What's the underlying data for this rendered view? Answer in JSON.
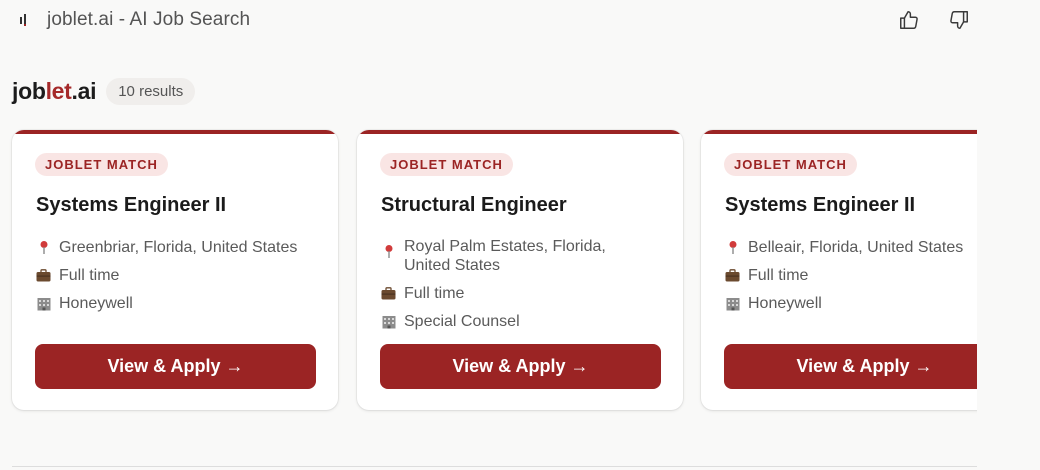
{
  "header": {
    "favicon_text": ".i",
    "title": "joblet.ai - AI Job Search",
    "thumbs_up_icon": "thumbs-up-icon",
    "thumbs_down_icon": "thumbs-down-icon"
  },
  "brand": {
    "part1": "job",
    "part2": "let",
    "part3": ".ai",
    "results": "10 results",
    "accent_color": "#9b2424"
  },
  "cards": [
    {
      "badge": "JOBLET MATCH",
      "title": "Systems Engineer II",
      "location": "Greenbriar, Florida, United States",
      "employment": "Full time",
      "company": "Honeywell",
      "apply_label": "View & Apply →"
    },
    {
      "badge": "JOBLET MATCH",
      "title": "Structural Engineer",
      "location": "Royal Palm Estates, Florida, United States",
      "employment": "Full time",
      "company": "Special Counsel",
      "apply_label": "View & Apply →"
    },
    {
      "badge": "JOBLET MATCH",
      "title": "Systems Engineer II",
      "location": "Belleair, Florida, United States",
      "employment": "Full time",
      "company": "Honeywell",
      "apply_label": "View & Apply →"
    }
  ],
  "icons": {
    "location": "pin-icon",
    "employment": "briefcase-icon",
    "company": "building-icon"
  }
}
